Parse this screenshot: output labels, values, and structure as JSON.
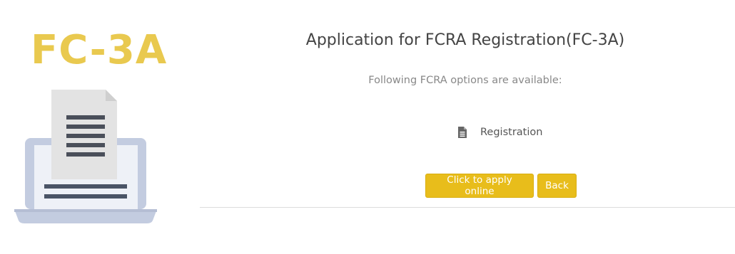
{
  "illustration": {
    "form_code": "FC-3A",
    "icon": "laptop-document-icon"
  },
  "header": {
    "title": "Application for FCRA Registration(FC-3A)",
    "subtitle": "Following FCRA options are available:"
  },
  "options": [
    {
      "icon": "file-text-icon",
      "label": "Registration"
    }
  ],
  "actions": {
    "apply_label": "Click to apply online",
    "back_label": "Back"
  },
  "colors": {
    "accent": "#e8bd1b",
    "code_text": "#e9c94f",
    "title_text": "#444444",
    "muted_text": "#888888"
  }
}
